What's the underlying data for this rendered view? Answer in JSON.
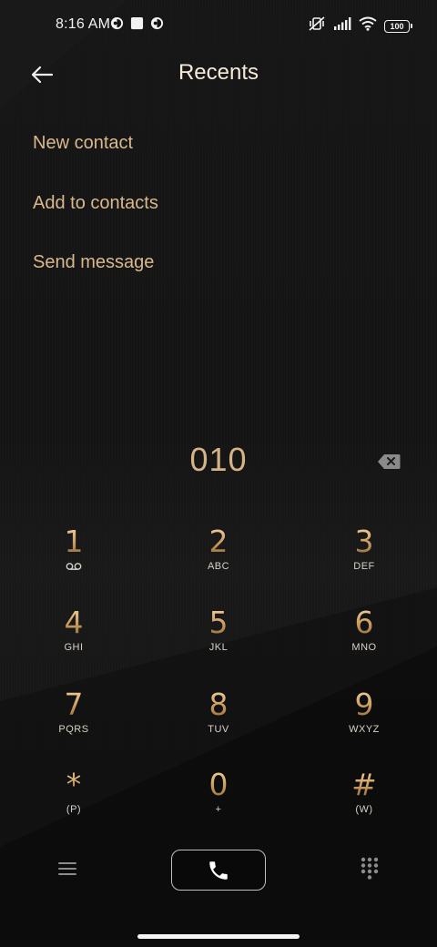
{
  "status_bar": {
    "time": "8:16 AM",
    "battery": "100"
  },
  "header": {
    "title": "Recents"
  },
  "options": [
    {
      "label": "New contact"
    },
    {
      "label": "Add to contacts"
    },
    {
      "label": "Send message"
    }
  ],
  "dialer": {
    "number": "010"
  },
  "keypad": [
    {
      "digit": "1",
      "letters": ""
    },
    {
      "digit": "2",
      "letters": "ABC"
    },
    {
      "digit": "3",
      "letters": "DEF"
    },
    {
      "digit": "4",
      "letters": "GHI"
    },
    {
      "digit": "5",
      "letters": "JKL"
    },
    {
      "digit": "6",
      "letters": "MNO"
    },
    {
      "digit": "7",
      "letters": "PQRS"
    },
    {
      "digit": "8",
      "letters": "TUV"
    },
    {
      "digit": "9",
      "letters": "WXYZ"
    },
    {
      "digit": "*",
      "letters": "(P)"
    },
    {
      "digit": "0",
      "letters": "+"
    },
    {
      "digit": "#",
      "letters": "(W)"
    }
  ],
  "icons": {
    "back": "arrow-left-icon",
    "backspace": "backspace-icon",
    "voicemail": "voicemail-icon",
    "menu": "menu-icon",
    "call": "phone-icon",
    "dialpad": "dialpad-icon"
  },
  "colors": {
    "accent_gold": "#d9b98c",
    "digit_gold": "#d5b386",
    "background": "#141414"
  }
}
